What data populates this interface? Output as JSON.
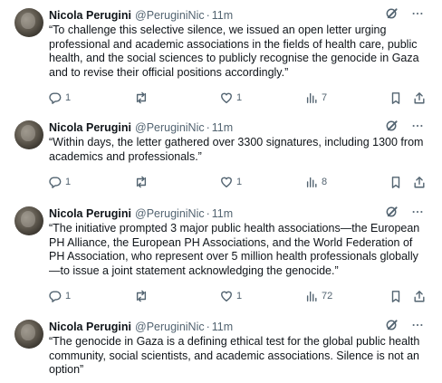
{
  "tweets": [
    {
      "author": "Nicola Perugini",
      "handle": "@PeruginiNic",
      "separator": "·",
      "time": "11m",
      "text": "“To challenge this selective silence, we issued an open letter urging professional and academic associations in the fields of health care, public health, and the social sciences to publicly recognise the genocide in Gaza and to revise their official positions accordingly.”",
      "replies": "1",
      "reposts": "",
      "likes": "1",
      "views": "7"
    },
    {
      "author": "Nicola Perugini",
      "handle": "@PeruginiNic",
      "separator": "·",
      "time": "11m",
      "text": "“Within days, the letter gathered over 3300 signatures, including 1300 from academics and professionals.”",
      "replies": "1",
      "reposts": "",
      "likes": "1",
      "views": "8"
    },
    {
      "author": "Nicola Perugini",
      "handle": "@PeruginiNic",
      "separator": "·",
      "time": "11m",
      "text": "“The initiative prompted 3 major public health associations—the European PH Alliance, the European PH Associations, and the World Federation of PH Association, who represent over 5 million health professionals globally—to issue a joint statement acknowledging the genocide.”",
      "replies": "1",
      "reposts": "",
      "likes": "1",
      "views": "72"
    },
    {
      "author": "Nicola Perugini",
      "handle": "@PeruginiNic",
      "separator": "·",
      "time": "11m",
      "text": "“The genocide in Gaza is a defining ethical test for the global public health community, social scientists, and academic associations. Silence is not an option”"
    }
  ],
  "icons": {
    "grok": "grok-icon",
    "more": "more-icon",
    "reply": "reply-icon",
    "repost": "repost-icon",
    "like": "like-icon",
    "views": "views-icon",
    "bookmark": "bookmark-icon",
    "share": "share-icon"
  },
  "colors": {
    "text": "#0f1419",
    "secondary": "#536471",
    "background": "#ffffff"
  }
}
